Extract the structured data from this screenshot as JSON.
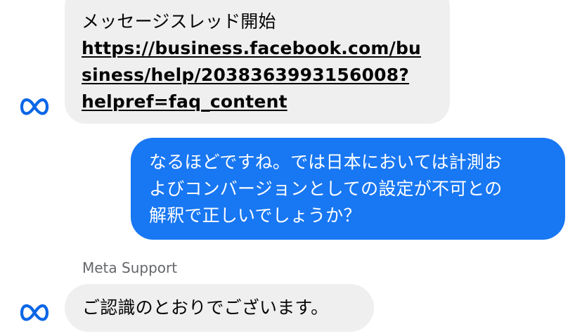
{
  "colors": {
    "accent": "#1877f2",
    "incoming_bubble": "#efefef",
    "sender_name": "#65676b",
    "meta_logo": "#0a66e6"
  },
  "messages": [
    {
      "direction": "incoming",
      "lines": [
        "メッセージスレッド開始"
      ],
      "link_lines": [
        "https://business.facebook.com/bu",
        "siness/help/2038363993156008?",
        "helpref=faq_content"
      ],
      "avatar_icon": "meta-logo-icon"
    },
    {
      "direction": "outgoing",
      "lines": [
        "なるほどですね。では日本においては計測お",
        "よびコンバージョンとしての設定が不可との",
        "解釈で正しいでしょうか？"
      ]
    },
    {
      "direction": "incoming",
      "sender": "Meta Support",
      "lines": [
        "ご認識のとおりでございます。"
      ],
      "avatar_icon": "meta-logo-icon"
    }
  ]
}
